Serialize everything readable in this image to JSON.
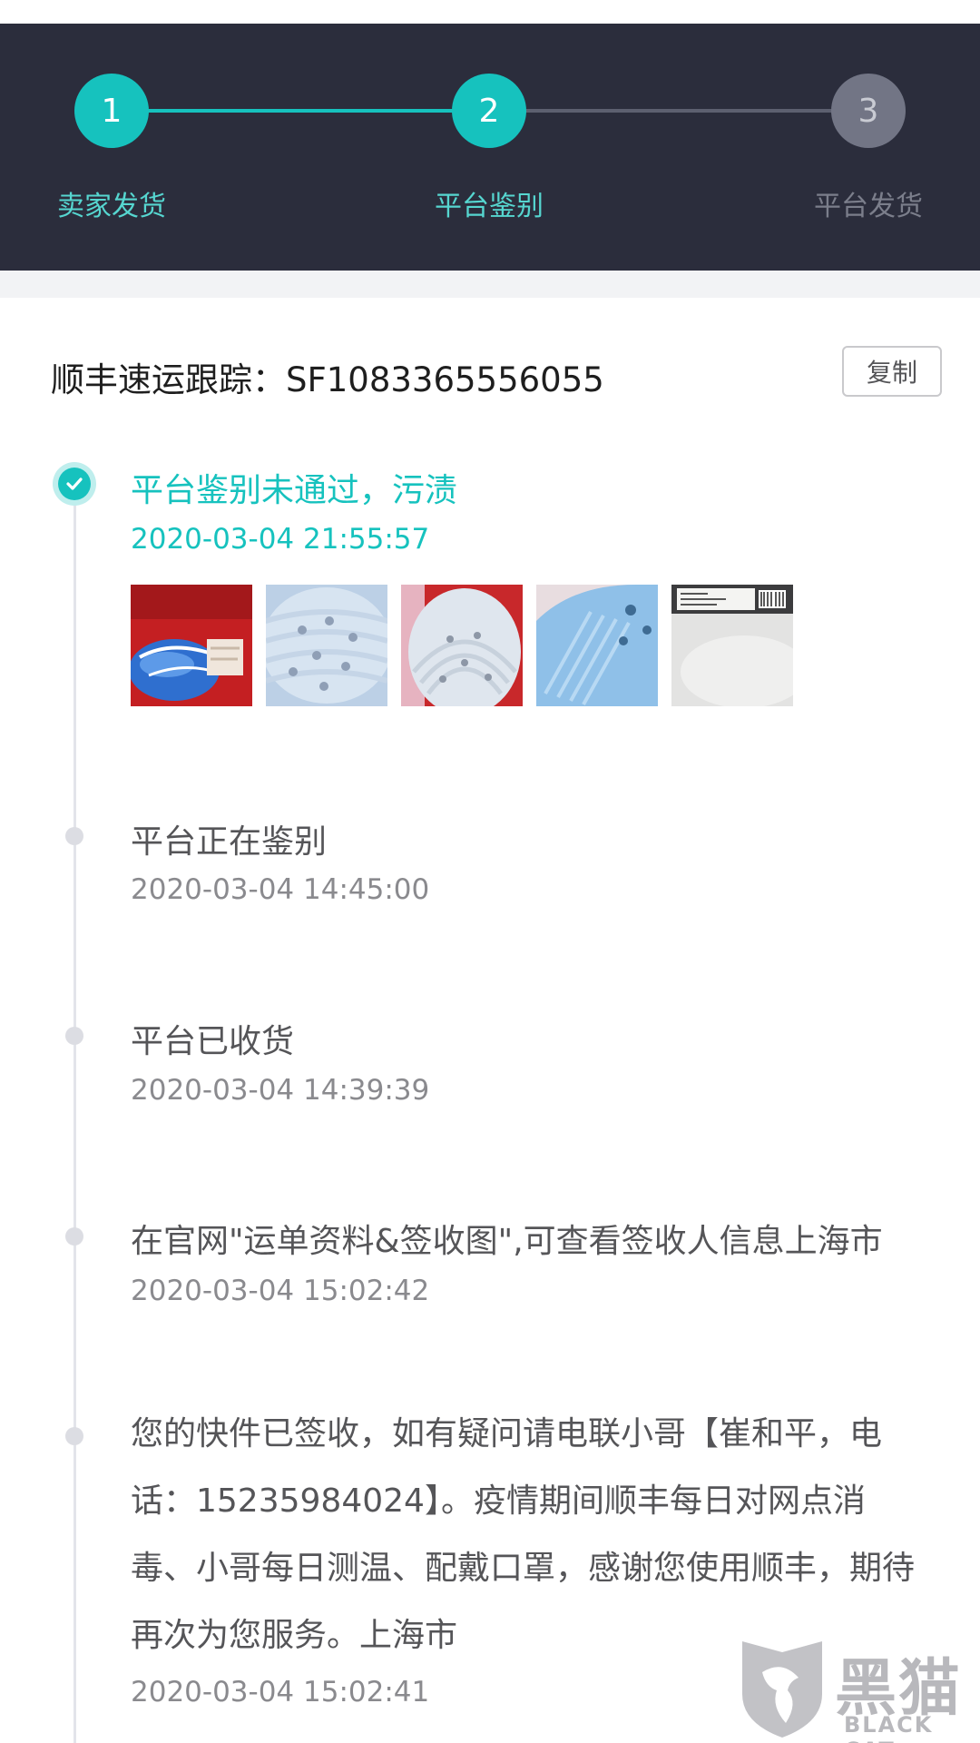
{
  "stepper": {
    "steps": [
      {
        "number": "1",
        "label": "卖家发货",
        "state": "done"
      },
      {
        "number": "2",
        "label": "平台鉴别",
        "state": "active"
      },
      {
        "number": "3",
        "label": "平台发货",
        "state": "pending"
      }
    ],
    "colors": {
      "active": "#16c2be",
      "inactive": "#727585",
      "background": "#2b2d3c"
    }
  },
  "tracking": {
    "label": "顺丰速运跟踪：SF1083365556055",
    "copy_button": "复制"
  },
  "events": [
    {
      "title": "平台鉴别未通过，污渍",
      "time": "2020-03-04 21:55:57",
      "status": "current",
      "photos": [
        "shoe-photo",
        "sole-photo",
        "sole-photo",
        "sole-closeup-photo",
        "box-label-photo"
      ]
    },
    {
      "title": "平台正在鉴别",
      "time": "2020-03-04 14:45:00"
    },
    {
      "title": "平台已收货",
      "time": "2020-03-04 14:39:39"
    },
    {
      "title": "在官网\"运单资料&签收图\",可查看签收人信息上海市",
      "time": "2020-03-04 15:02:42"
    },
    {
      "title": "您的快件已签收，如有疑问请电联小哥【崔和平，电话：15235984024】。疫情期间顺丰每日对网点消毒、小哥每日测温、配戴口罩，感谢您使用顺丰，期待再次为您服务。上海市",
      "time": "2020-03-04 15:02:41"
    }
  ],
  "watermark": {
    "text": "黑猫",
    "subtext": "BLACK CAT"
  }
}
